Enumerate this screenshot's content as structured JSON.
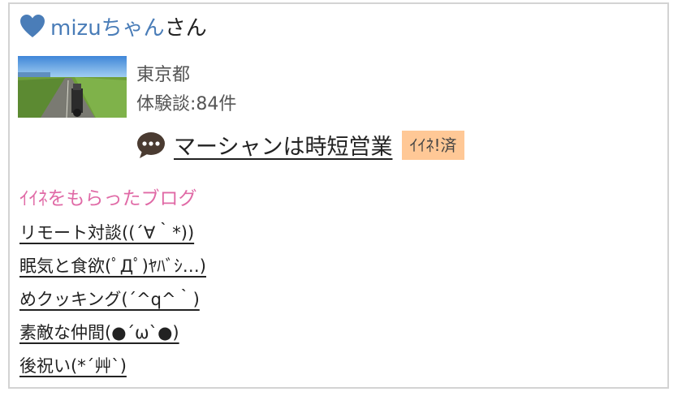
{
  "user": {
    "name": "mizuちゃん",
    "honorific": "さん",
    "location": "東京都",
    "stories": "体験談:84件"
  },
  "icons": {
    "heart": "heart-icon",
    "comment": "speech-bubble-icon",
    "heart_color": "#4a7db8"
  },
  "latest_post": {
    "title": "マーシャンは時短営業",
    "badge": "ｲｲﾈ!済"
  },
  "liked_blogs": {
    "heading": "ｲｲﾈをもらったブログ",
    "items": [
      "リモート対談((´∀｀*))",
      "眠気と食欲(ﾟДﾟ)ﾔﾊﾞｼ…) ",
      "めクッキング(´^q^｀)",
      "素敵な仲間(●´ω`●)",
      "後祝い(*´艸`)"
    ]
  },
  "colors": {
    "accent_pink": "#e06aa6",
    "badge_bg": "#ffc896",
    "link_blue": "#4a7db8"
  }
}
